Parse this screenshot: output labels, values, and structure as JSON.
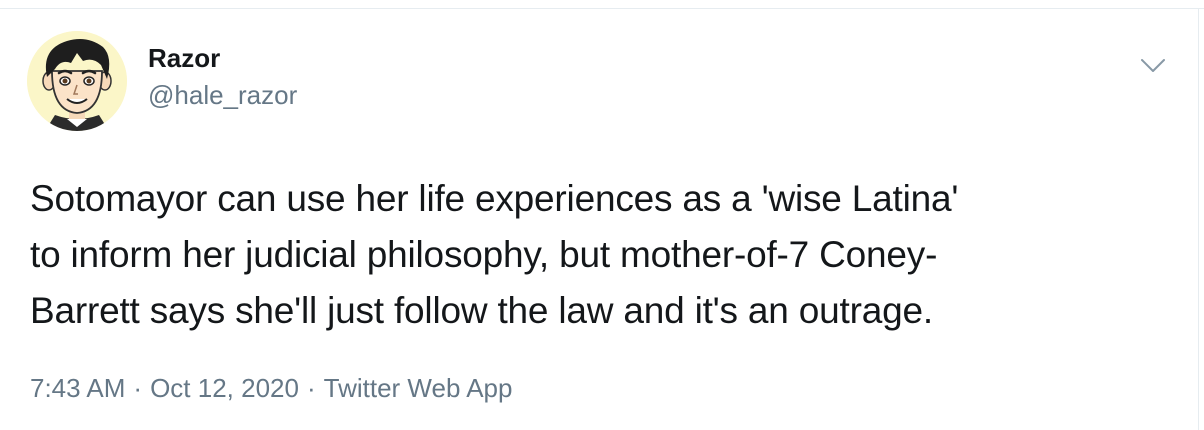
{
  "tweet": {
    "author": {
      "display_name": "Razor",
      "handle": "@hale_razor",
      "avatar": "cartoon-face-avatar"
    },
    "text_lines": [
      "Sotomayor can use her life experiences as a 'wise Latina'",
      "to inform her judicial philosophy, but mother-of-7 Coney-",
      "Barrett says she'll just follow the law and it's an outrage."
    ],
    "time": "7:43 AM",
    "separator": "·",
    "date": "Oct 12, 2020",
    "source": "Twitter Web App",
    "menu_icon": "chevron-down-icon"
  },
  "colors": {
    "text": "#14171a",
    "secondary": "#657786",
    "border": "#e6ecf0",
    "avatar_bg": "#fbf6c8"
  }
}
